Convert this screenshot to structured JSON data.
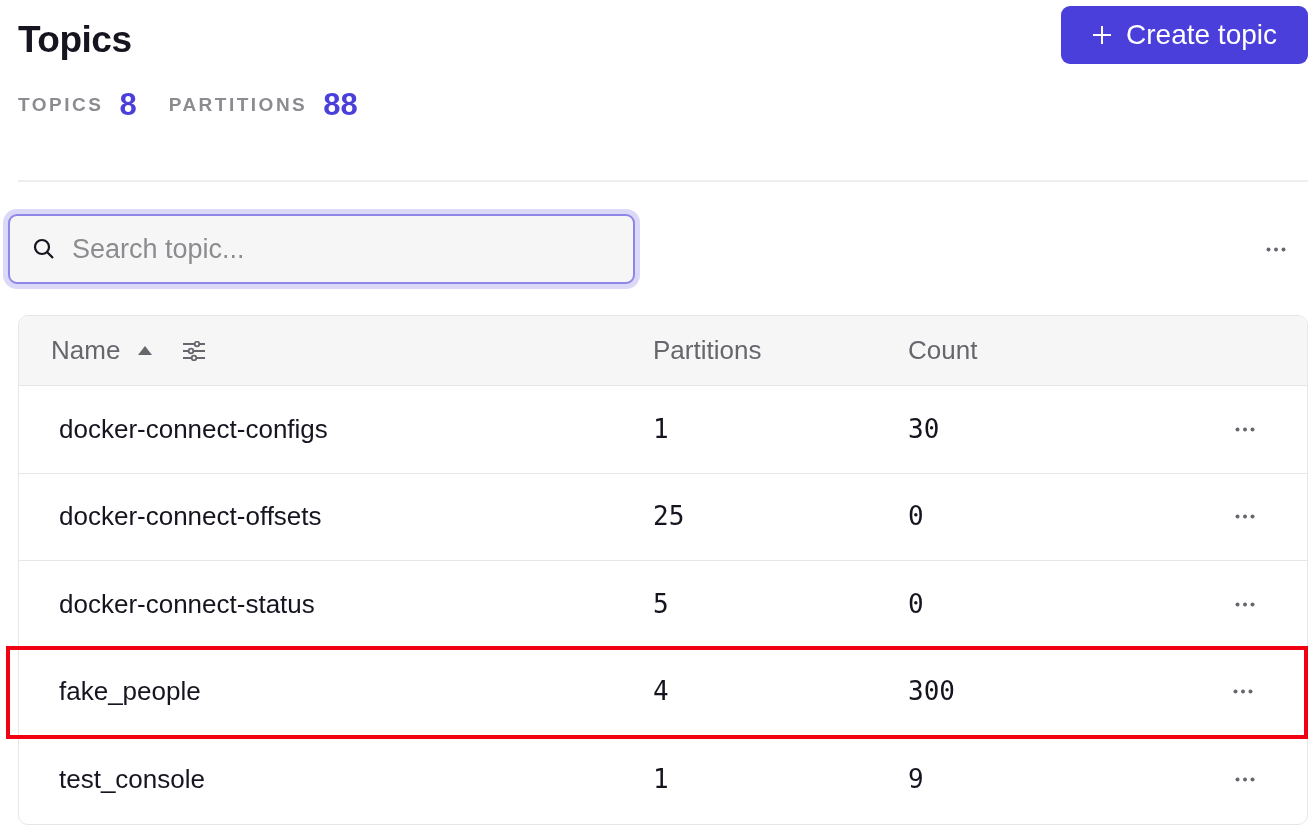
{
  "title": "Topics",
  "create_button": {
    "label": "Create topic"
  },
  "stats": [
    {
      "label": "TOPICS",
      "value": "8"
    },
    {
      "label": "PARTITIONS",
      "value": "88"
    }
  ],
  "search": {
    "placeholder": "Search topic...",
    "focused": true
  },
  "table": {
    "columns": [
      {
        "label": "Name",
        "sorted_ascending": true,
        "filter": true
      },
      {
        "label": "Partitions"
      },
      {
        "label": "Count"
      }
    ],
    "rows": [
      {
        "name": "docker-connect-configs",
        "partitions": "1",
        "count": "30",
        "highlighted": false
      },
      {
        "name": "docker-connect-offsets",
        "partitions": "25",
        "count": "0",
        "highlighted": false
      },
      {
        "name": "docker-connect-status",
        "partitions": "5",
        "count": "0",
        "highlighted": false
      },
      {
        "name": "fake_people",
        "partitions": "4",
        "count": "300",
        "highlighted": true
      },
      {
        "name": "test_console",
        "partitions": "1",
        "count": "9",
        "highlighted": false
      }
    ]
  }
}
